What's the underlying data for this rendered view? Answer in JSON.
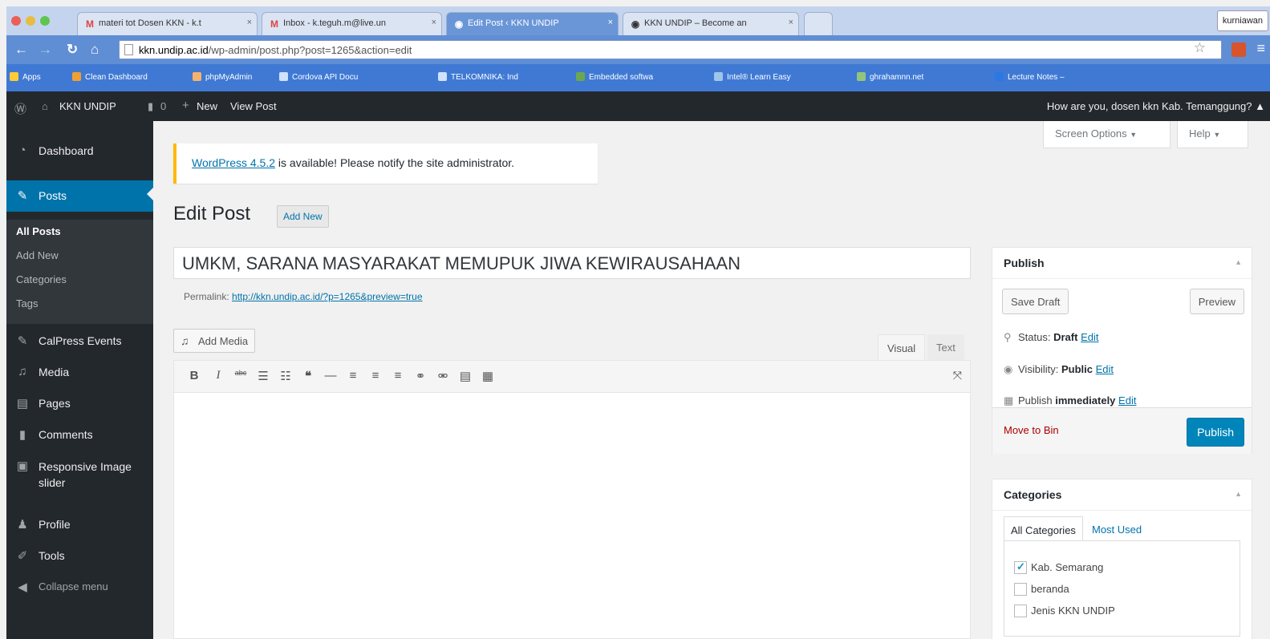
{
  "browser": {
    "tabs": [
      {
        "label": "materi tot Dosen KKN - k.t",
        "icon": "gmail-icon",
        "active": false
      },
      {
        "label": "Inbox - k.teguh.m@live.un",
        "icon": "gmail-icon",
        "active": false
      },
      {
        "label": "Edit Post ‹ KKN UNDIP",
        "icon": "wordpress-icon",
        "active": true
      },
      {
        "label": "KKN UNDIP – Become an",
        "icon": "wordpress-icon",
        "active": false
      }
    ],
    "profile_name": "kurniawan",
    "url_host": "kkn.undip.ac.id",
    "url_path": "/wp-admin/post.php?post=1265&action=edit",
    "bookmarks": [
      {
        "label": "Apps",
        "color": "#ffcc33"
      },
      {
        "label": "Clean Dashboard",
        "color": "#f0a030"
      },
      {
        "label": "phpMyAdmin",
        "color": "#f6b26b"
      },
      {
        "label": "Cordova API Docu",
        "color": "#cfe2ff"
      },
      {
        "label": "TELKOMNIKA: Ind",
        "color": "#cfe2ff"
      },
      {
        "label": "Embedded softwa",
        "color": "#6aa84f"
      },
      {
        "label": "Intel® Learn Easy",
        "color": "#9fc5e8"
      },
      {
        "label": "ghrahamnn.net",
        "color": "#93c47d"
      },
      {
        "label": "Lecture Notes –",
        "color": "#2b78e4"
      }
    ]
  },
  "adminbar": {
    "site_name": "KKN UNDIP",
    "comments_count": "0",
    "new_label": "New",
    "view_post_label": "View Post",
    "greeting": "How are you, dosen kkn Kab. Temanggung?"
  },
  "sidebar": {
    "items": [
      {
        "label": "Dashboard",
        "icon": "dashboard-icon"
      },
      {
        "label": "Posts",
        "icon": "pin-icon"
      },
      {
        "label": "CalPress Events",
        "icon": "pin-icon"
      },
      {
        "label": "Media",
        "icon": "media-icon"
      },
      {
        "label": "Pages",
        "icon": "pages-icon"
      },
      {
        "label": "Comments",
        "icon": "comment-icon"
      },
      {
        "label": "Responsive Image slider",
        "icon": "slider-icon"
      },
      {
        "label": "Profile",
        "icon": "user-icon"
      },
      {
        "label": "Tools",
        "icon": "wrench-icon"
      },
      {
        "label": "Collapse menu",
        "icon": "collapse-icon"
      }
    ],
    "posts_submenu": [
      "All Posts",
      "Add New",
      "Categories",
      "Tags"
    ]
  },
  "screen_meta": {
    "screen_options": "Screen Options",
    "help": "Help"
  },
  "notice": {
    "link": "WordPress 4.5.2",
    "text": " is available! Please notify the site administrator."
  },
  "page": {
    "title": "Edit Post",
    "add_new": "Add New"
  },
  "post": {
    "title": "UMKM, SARANA MASYARAKAT MEMUPUK JIWA KEWIRAUSAHAAN",
    "permalink_label": "Permalink:",
    "permalink_url": "http://kkn.undip.ac.id/?p=1265&preview=true"
  },
  "editor": {
    "add_media": "Add Media",
    "tab_visual": "Visual",
    "tab_text": "Text"
  },
  "publish_box": {
    "title": "Publish",
    "save_draft": "Save Draft",
    "preview": "Preview",
    "status_label": "Status:",
    "status_value": "Draft",
    "visibility_label": "Visibility:",
    "visibility_value": "Public",
    "publish_label": "Publish",
    "publish_value": "immediately",
    "edit_link": "Edit",
    "move_to_bin": "Move to Bin",
    "publish_button": "Publish"
  },
  "categories_box": {
    "title": "Categories",
    "tab_all": "All Categories",
    "tab_most_used": "Most Used",
    "items": [
      {
        "label": "Kab. Semarang",
        "checked": true
      },
      {
        "label": "beranda",
        "checked": false
      },
      {
        "label": "Jenis KKN UNDIP",
        "checked": false
      }
    ]
  },
  "colors": {
    "admin_dark": "#23282d",
    "admin_blue": "#0073aa",
    "publish_blue": "#0085ba",
    "notice_yellow": "#ffb900"
  }
}
